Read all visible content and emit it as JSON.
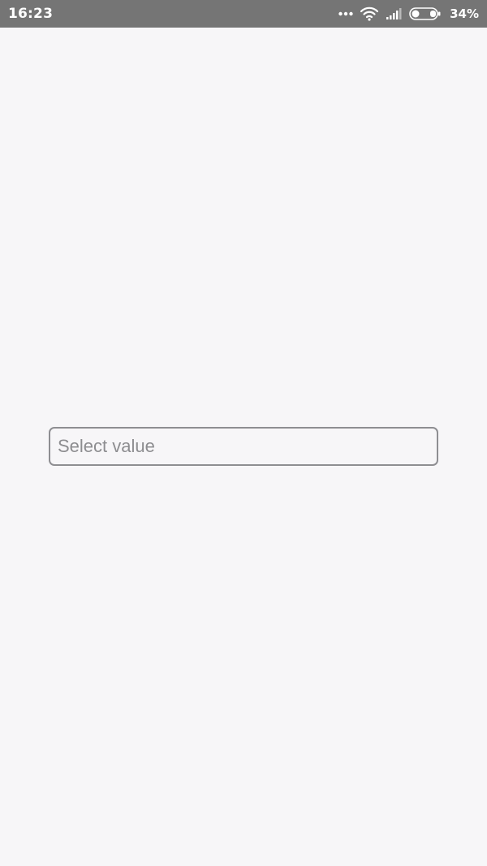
{
  "status_bar": {
    "time": "16:23",
    "battery_percent": "34%",
    "battery_level": 0.34,
    "icons": [
      "more-dots-icon",
      "wifi-icon",
      "signal-icon",
      "battery-icon"
    ]
  },
  "form": {
    "select": {
      "placeholder": "Select value"
    }
  },
  "colors": {
    "status_bar_bg": "#757575",
    "page_bg": "#f7f6f8",
    "field_border": "#8e8e92",
    "placeholder_text": "#8d8d90"
  }
}
